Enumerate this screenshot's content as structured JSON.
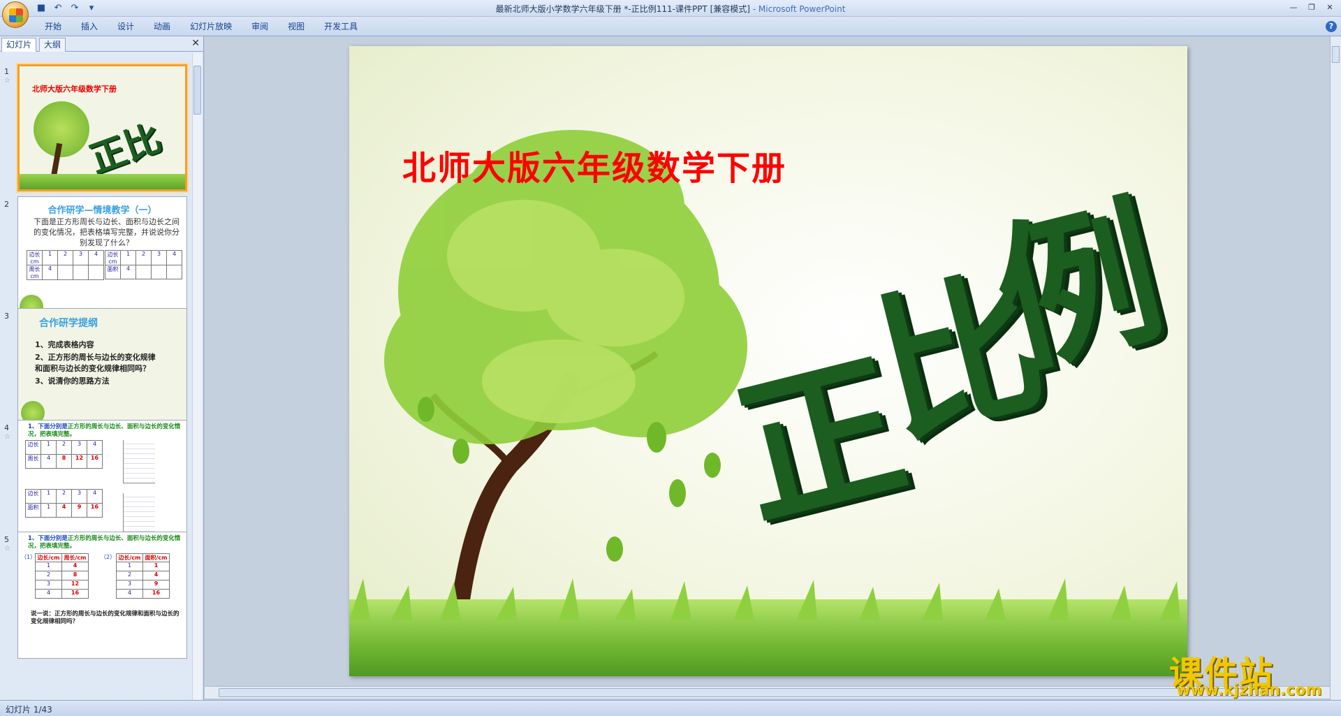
{
  "window": {
    "title": "最新北师大版小学数学六年级下册 *-正比例111-课件PPT [兼容模式]",
    "app_name": " - Microsoft PowerPoint"
  },
  "ribbon": {
    "tabs": [
      "开始",
      "插入",
      "设计",
      "动画",
      "幻灯片放映",
      "审阅",
      "视图",
      "开发工具"
    ]
  },
  "panel": {
    "tabs": [
      "幻灯片",
      "大纲"
    ],
    "close_glyph": "✕"
  },
  "thumbnails": {
    "t1": {
      "number": "1",
      "subtitle": "北师大版六年级数学下册",
      "title": "正比例"
    },
    "t2": {
      "number": "2",
      "title": "合作研学—情境教学（一）",
      "text": "下面是正方形周长与边长、面积与边长之间的变化情况，把表格填写完整，并说说你分别发现了什么？",
      "table_a": {
        "row_label_1": "边长cm",
        "row_label_2": "周长cm",
        "header": [
          "1",
          "2",
          "3",
          "4"
        ],
        "row2": [
          "4",
          "",
          "",
          ""
        ]
      },
      "table_b": {
        "row_label_1": "边长cm",
        "row_label_2": "面积",
        "header": [
          "1",
          "2",
          "3",
          "4"
        ],
        "row2": [
          "4",
          "",
          "",
          ""
        ]
      }
    },
    "t3": {
      "number": "3",
      "title": "合作研学提纲",
      "items": [
        "1、完成表格内容",
        "2、正方形的周长与边长的变化规律",
        "和面积与边长的变化规律相同吗？",
        "3、说清你的思路方法"
      ]
    },
    "t4": {
      "number": "4",
      "title_a": "1、下面分别是",
      "title_b": "正方形的周长与边长、面积与边长的变化情况，把表填完整。",
      "table_a": {
        "header": [
          "1",
          "2",
          "3",
          "4"
        ],
        "row2": [
          "4",
          "8",
          "12",
          "16"
        ]
      },
      "table_b": {
        "header": [
          "1",
          "2",
          "3",
          "4"
        ],
        "row2": [
          "1",
          "4",
          "9",
          "16"
        ]
      }
    },
    "t5": {
      "number": "5",
      "title_a": "1、下面分别是",
      "title_b": "正方形的周长与边长、面积与边长的变化情况，把表填完整。",
      "label_1": "（1）",
      "label_2": "（2）",
      "table_a": {
        "header": [
          "边长/cm",
          "周长/cm"
        ],
        "rows": [
          [
            "1",
            "4"
          ],
          [
            "2",
            "8"
          ],
          [
            "3",
            "12"
          ],
          [
            "4",
            "16"
          ]
        ]
      },
      "table_b": {
        "header": [
          "边长/cm",
          "面积/cm"
        ],
        "rows": [
          [
            "1",
            "1"
          ],
          [
            "2",
            "4"
          ],
          [
            "3",
            "9"
          ],
          [
            "4",
            "16"
          ]
        ]
      },
      "footer": "说一说：正方形的周长与边长的变化规律和面积与边长的变化规律相同吗？"
    }
  },
  "slide": {
    "subtitle": "北师大版六年级数学下册",
    "title_chars": [
      "正",
      "比",
      "例"
    ]
  },
  "status": {
    "slide_counter": "幻灯片 1/43"
  },
  "watermark": {
    "cn": "课件站",
    "url": "www.kjzhan.com"
  },
  "colors": {
    "subtitle": "#ff0000",
    "title_green": "#1b5e20",
    "grass": "#71b832",
    "watermark": "#f0c800"
  }
}
